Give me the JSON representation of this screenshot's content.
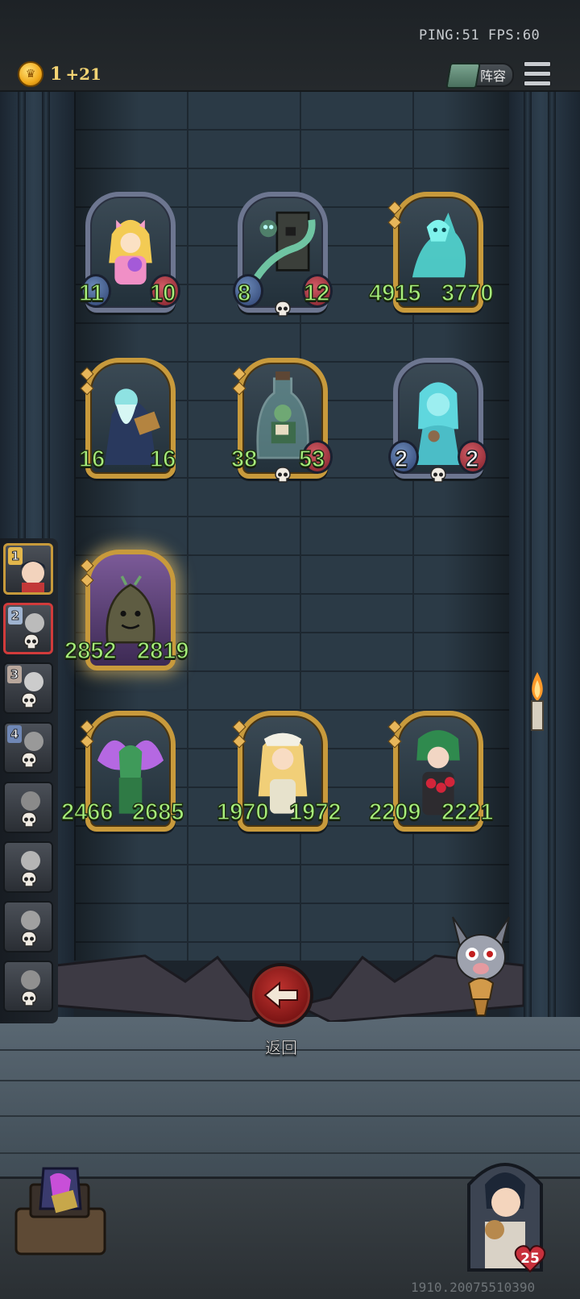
{
  "header": {
    "ping_fps": "PING:51   FPS:60",
    "coins": "1",
    "coin_income": "+21",
    "lineup_label": "阵容"
  },
  "board": {
    "units": [
      {
        "id": "magical-girl",
        "attack": "11",
        "health": "10",
        "frame": "silver",
        "has_skull": false
      },
      {
        "id": "lurker-block",
        "attack": "8",
        "health": "12",
        "frame": "silver",
        "has_skull": true
      },
      {
        "id": "spectral-wolf",
        "attack": "4915",
        "health": "3770",
        "frame": "gold",
        "has_skull": false
      },
      {
        "id": "ghost-sage",
        "attack": "16",
        "health": "16",
        "frame": "gold",
        "has_skull": false
      },
      {
        "id": "bottled-reader",
        "attack": "38",
        "health": "53",
        "frame": "gold",
        "has_skull": true
      },
      {
        "id": "ghost-girl",
        "attack": "2",
        "health": "2",
        "frame": "silver",
        "has_skull": true
      },
      {
        "id": "rock-golem",
        "attack": "2852",
        "health": "2819",
        "frame": "gold",
        "has_skull": false
      },
      {
        "id": "fairy-druid",
        "attack": "2466",
        "health": "2685",
        "frame": "gold",
        "has_skull": false
      },
      {
        "id": "elf-maiden",
        "attack": "1970",
        "health": "1972",
        "frame": "gold",
        "has_skull": false
      },
      {
        "id": "berry-witch",
        "attack": "2209",
        "health": "2221",
        "frame": "gold",
        "has_skull": false
      }
    ]
  },
  "roster": {
    "ranks": [
      "1",
      "2",
      "3",
      "4"
    ]
  },
  "back": {
    "label": "返回"
  },
  "hero": {
    "health": "25"
  },
  "footer": {
    "version": "1910.20075510390"
  },
  "colors": {
    "stat_green": "#a8f07c",
    "frame_gold": "#c89a3c",
    "frame_silver": "#6d7690",
    "back_red": "#c0332f"
  }
}
